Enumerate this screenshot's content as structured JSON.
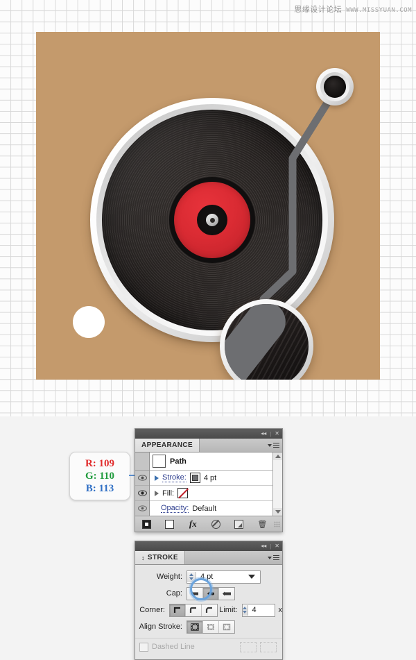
{
  "watermark": {
    "cn": "思缘设计论坛",
    "url": "WWW.MISSYUAN.COM"
  },
  "artboard": {
    "name": "vinyl-record-illustration",
    "background_color": "#c49a6c",
    "elements": {
      "record_label_color": "#d42b33",
      "vinyl_color": "#241f1e",
      "rim_color": "#ffffff",
      "tonearm_color": "#6d6e71",
      "white_dot_color": "#ffffff"
    }
  },
  "callout": {
    "r_label": "R: 109",
    "g_label": "G: 110",
    "b_label": "B: 113",
    "r_value": 109,
    "g_value": 110,
    "b_value": 113,
    "hex": "#6d6e71"
  },
  "appearance_panel": {
    "tab_label": "APPEARANCE",
    "target_label": "Path",
    "rows": [
      {
        "label": "Stroke:",
        "value": "4 pt",
        "swatch": "gray-stroke-swatch"
      },
      {
        "label": "Fill:",
        "value": "",
        "swatch": "none-swatch"
      },
      {
        "label": "Opacity:",
        "value": "Default",
        "swatch": ""
      }
    ],
    "toolbar": [
      {
        "icon": "add-new-fill-icon",
        "label": "Add New Fill"
      },
      {
        "icon": "add-new-stroke-icon",
        "label": "Add New Stroke"
      },
      {
        "icon": "fx-icon",
        "label": "fx"
      },
      {
        "icon": "clear-appearance-icon",
        "label": "Clear Appearance"
      },
      {
        "icon": "duplicate-item-icon",
        "label": "Duplicate Selected Item"
      },
      {
        "icon": "delete-item-icon",
        "label": "Delete Selected Item"
      }
    ]
  },
  "stroke_panel": {
    "tab_label": "STROKE",
    "weight": {
      "label": "Weight:",
      "value": "4 pt"
    },
    "cap": {
      "label": "Cap:",
      "options": [
        "butt-cap",
        "round-cap",
        "projecting-cap"
      ],
      "selected_index": 1
    },
    "corner": {
      "label": "Corner:",
      "options": [
        "miter-join",
        "round-join",
        "bevel-join"
      ],
      "selected_index": 0
    },
    "limit": {
      "label": "Limit:",
      "value": "4",
      "unit": "x"
    },
    "align_stroke": {
      "label": "Align Stroke:",
      "options": [
        "align-center",
        "align-inside",
        "align-outside"
      ],
      "selected_index": 0
    },
    "dashed_line": {
      "label": "Dashed Line",
      "checked": false,
      "enabled": false
    }
  }
}
